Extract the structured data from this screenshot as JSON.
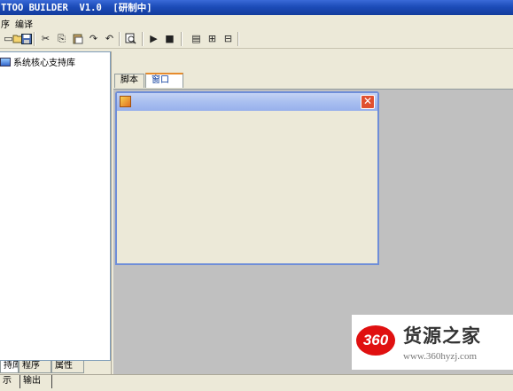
{
  "app": {
    "title": "TTOO BUILDER  V1.0  [研制中]"
  },
  "menu": {
    "items": [
      "序",
      "编译"
    ]
  },
  "toolbar": {
    "buttons": [
      {
        "name": "new-icon",
        "glyph": "▭"
      },
      {
        "name": "open-icon",
        "glyph": "📂"
      },
      {
        "name": "save-icon",
        "glyph": "💾"
      },
      {
        "name": "cut-icon",
        "glyph": "✂"
      },
      {
        "name": "copy-icon",
        "glyph": "⎘"
      },
      {
        "name": "paste-icon",
        "glyph": "📋"
      },
      {
        "name": "redo-icon",
        "glyph": "↷"
      },
      {
        "name": "undo-icon",
        "glyph": "↶"
      },
      {
        "name": "find-icon",
        "glyph": "🔍"
      },
      {
        "name": "run-icon",
        "glyph": "▶"
      },
      {
        "name": "stop-icon",
        "glyph": "■"
      },
      {
        "name": "layout-a-icon",
        "glyph": "▤"
      },
      {
        "name": "layout-b-icon",
        "glyph": "⊞"
      },
      {
        "name": "layout-c-icon",
        "glyph": "⊟"
      }
    ]
  },
  "tree": {
    "root_label": "系统核心支持库"
  },
  "left_tabs": [
    "持库",
    "程序",
    "属性"
  ],
  "bottom_tabs": [
    "示",
    "输出"
  ],
  "doc_tabs": [
    {
      "label": "脚本",
      "active": false
    },
    {
      "label": "窗口",
      "active": true
    }
  ],
  "form_window": {
    "close_glyph": "✕"
  },
  "watermark": {
    "badge": "360",
    "title": "货源之家",
    "url": "www.360hyzj.com"
  }
}
